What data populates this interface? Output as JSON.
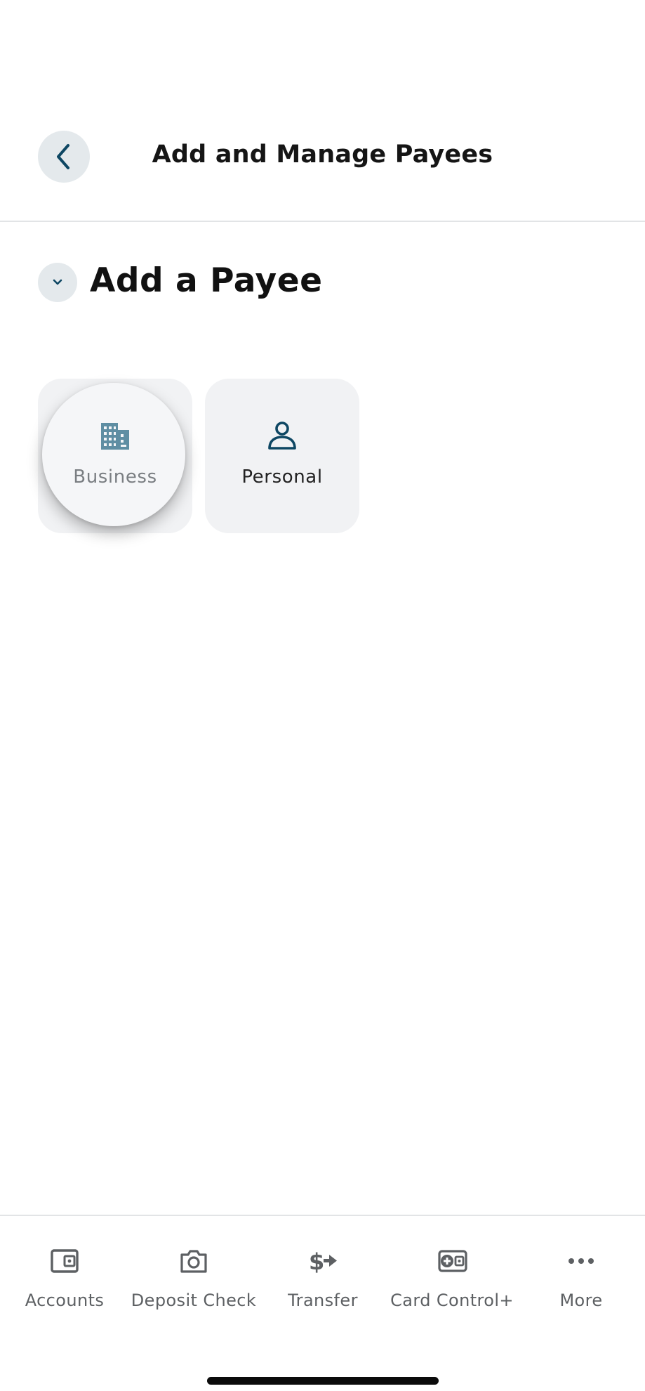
{
  "header": {
    "title": "Add and Manage Payees",
    "back_icon": "chevron-left-icon"
  },
  "section": {
    "title": "Add a Payee",
    "toggle_icon": "chevron-down-icon",
    "state": "expanded"
  },
  "payee_types": [
    {
      "label": "Business",
      "icon": "building-icon",
      "pressed": true
    },
    {
      "label": "Personal",
      "icon": "person-icon",
      "pressed": false
    }
  ],
  "bottom_nav": [
    {
      "label": "Accounts",
      "icon": "wallet-icon"
    },
    {
      "label": "Deposit Check",
      "icon": "camera-icon"
    },
    {
      "label": "Transfer",
      "icon": "dollar-transfer-icon"
    },
    {
      "label": "Card Control+",
      "icon": "card-control-icon"
    },
    {
      "label": "More",
      "icon": "more-dots-icon"
    }
  ],
  "colors": {
    "accent_dark": "#0e4763",
    "accent_muted": "#5f8ea3",
    "tile_bg": "#f1f2f4",
    "button_bg": "#e4e9ec",
    "nav_icon": "#5d6063"
  }
}
